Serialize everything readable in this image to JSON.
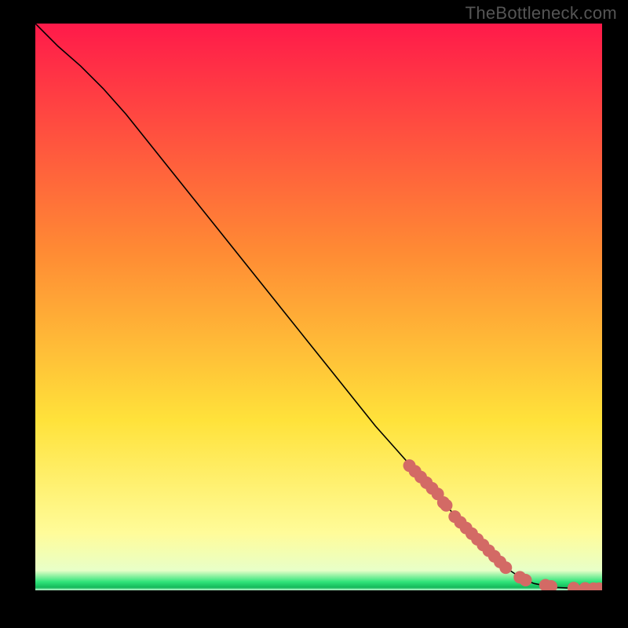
{
  "watermark": "TheBottleneck.com",
  "palette": {
    "gradient_top": "#ff1a4a",
    "gradient_mid1": "#ff8a34",
    "gradient_mid2": "#ffe23a",
    "gradient_mid3": "#fffc9a",
    "gradient_green": "#30e47a",
    "marker": "#d36a65",
    "line": "#000000"
  },
  "chart_data": {
    "type": "line",
    "title": "",
    "xlabel": "",
    "ylabel": "",
    "xlim": [
      0,
      100
    ],
    "ylim": [
      0,
      100
    ],
    "series": [
      {
        "name": "curve",
        "x": [
          0,
          4,
          8,
          12,
          16,
          20,
          24,
          28,
          32,
          36,
          40,
          44,
          48,
          52,
          56,
          60,
          64,
          68,
          72,
          76,
          80,
          83,
          86,
          88,
          90,
          92,
          94,
          96,
          98,
          100
        ],
        "y": [
          100,
          96,
          92.5,
          88.5,
          84,
          79,
          74,
          69,
          64,
          59,
          54,
          49,
          44,
          39,
          34,
          29,
          24.5,
          20,
          15.5,
          11,
          7,
          4,
          2,
          1.2,
          0.8,
          0.5,
          0.4,
          0.3,
          0.3,
          0.3
        ]
      }
    ],
    "markers": {
      "name": "dots",
      "x": [
        66,
        67,
        68,
        69,
        70,
        71,
        72,
        72.5,
        74,
        75,
        76,
        77,
        78,
        79,
        80,
        81,
        82,
        83,
        85.5,
        86.5,
        90,
        91,
        95,
        97,
        98.5,
        99.5
      ],
      "y": [
        22,
        21,
        20,
        19,
        18,
        17,
        15.5,
        15,
        13,
        12,
        11,
        10,
        9,
        8,
        7,
        6,
        5,
        4,
        2.3,
        1.8,
        0.9,
        0.7,
        0.4,
        0.35,
        0.3,
        0.3
      ]
    }
  }
}
